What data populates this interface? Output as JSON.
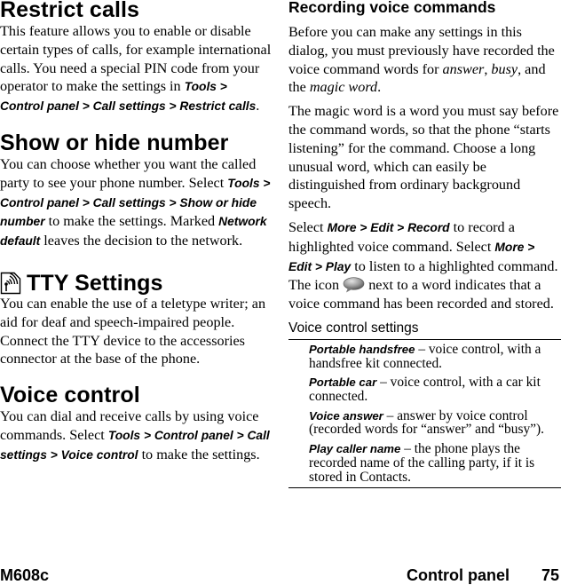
{
  "left_column": {
    "restrict_calls": {
      "heading": "Restrict calls",
      "text_1": "This feature allows you to enable or disable certain types of calls, for example international calls. You need a special PIN code from your operator to make the settings in ",
      "path": "Tools > Control panel > Call settings > Restrict calls",
      "text_2": "."
    },
    "show_hide_number": {
      "heading": "Show or hide number",
      "text_1": "You can choose whether you want the called party to see your phone number. Select ",
      "path": "Tools > Control panel > Call settings > Show or hide number",
      "text_2": " to make the settings. Marked ",
      "option": "Network default",
      "text_3": " leaves the decision to the network."
    },
    "tty_settings": {
      "icon": "tty-antenna-icon",
      "heading": "TTY Settings",
      "text": "You can enable the use of a teletype writer; an aid for deaf and speech-impaired people. Connect the TTY device to the accessories connector at the base of the phone."
    },
    "voice_control": {
      "heading": "Voice control",
      "text_1": "You can dial and receive calls by using voice commands. Select ",
      "path": "Tools > Control panel > Call settings > Voice control",
      "text_2": " to make the settings."
    }
  },
  "right_column": {
    "recording": {
      "heading": "Recording voice commands",
      "p1_text_1": "Before you can make any settings in this dialog, you must previously have recorded the voice command words for ",
      "p1_answer": "answer",
      "p1_comma": ", ",
      "p1_busy": "busy",
      "p1_text_2": ", and the ",
      "p1_magic": "magic word",
      "p1_text_3": ".",
      "p2": "The magic word is a word you must say before the command words, so that the phone “starts listening” for the command. Choose a long unusual word, which can easily be distinguished from ordinary background speech.",
      "p3_text_1": "Select ",
      "p3_path_1": "More > Edit > Record",
      "p3_text_2": " to record a highlighted voice command. Select ",
      "p3_path_2": "More > Edit > Play",
      "p3_text_3": " to listen to a highlighted command. The icon ",
      "p3_icon": "speech-bubble-icon",
      "p3_text_4": " next to a word indicates that a voice command has been recorded and stored."
    },
    "settings_table": {
      "title": "Voice control settings",
      "items": [
        {
          "term": "Portable handsfree",
          "desc": " – voice control, with a handsfree kit connected."
        },
        {
          "term": "Portable car",
          "desc": " – voice control, with a car kit connected."
        },
        {
          "term": "Voice answer",
          "desc": " – answer by voice control (recorded words for “answer” and “busy”)."
        },
        {
          "term": "Play caller name",
          "desc": " – the phone plays the recorded name of the calling party, if it is stored in Contacts."
        }
      ]
    }
  },
  "footer": {
    "model": "M608c",
    "section": "Control panel",
    "page_number": "75"
  }
}
